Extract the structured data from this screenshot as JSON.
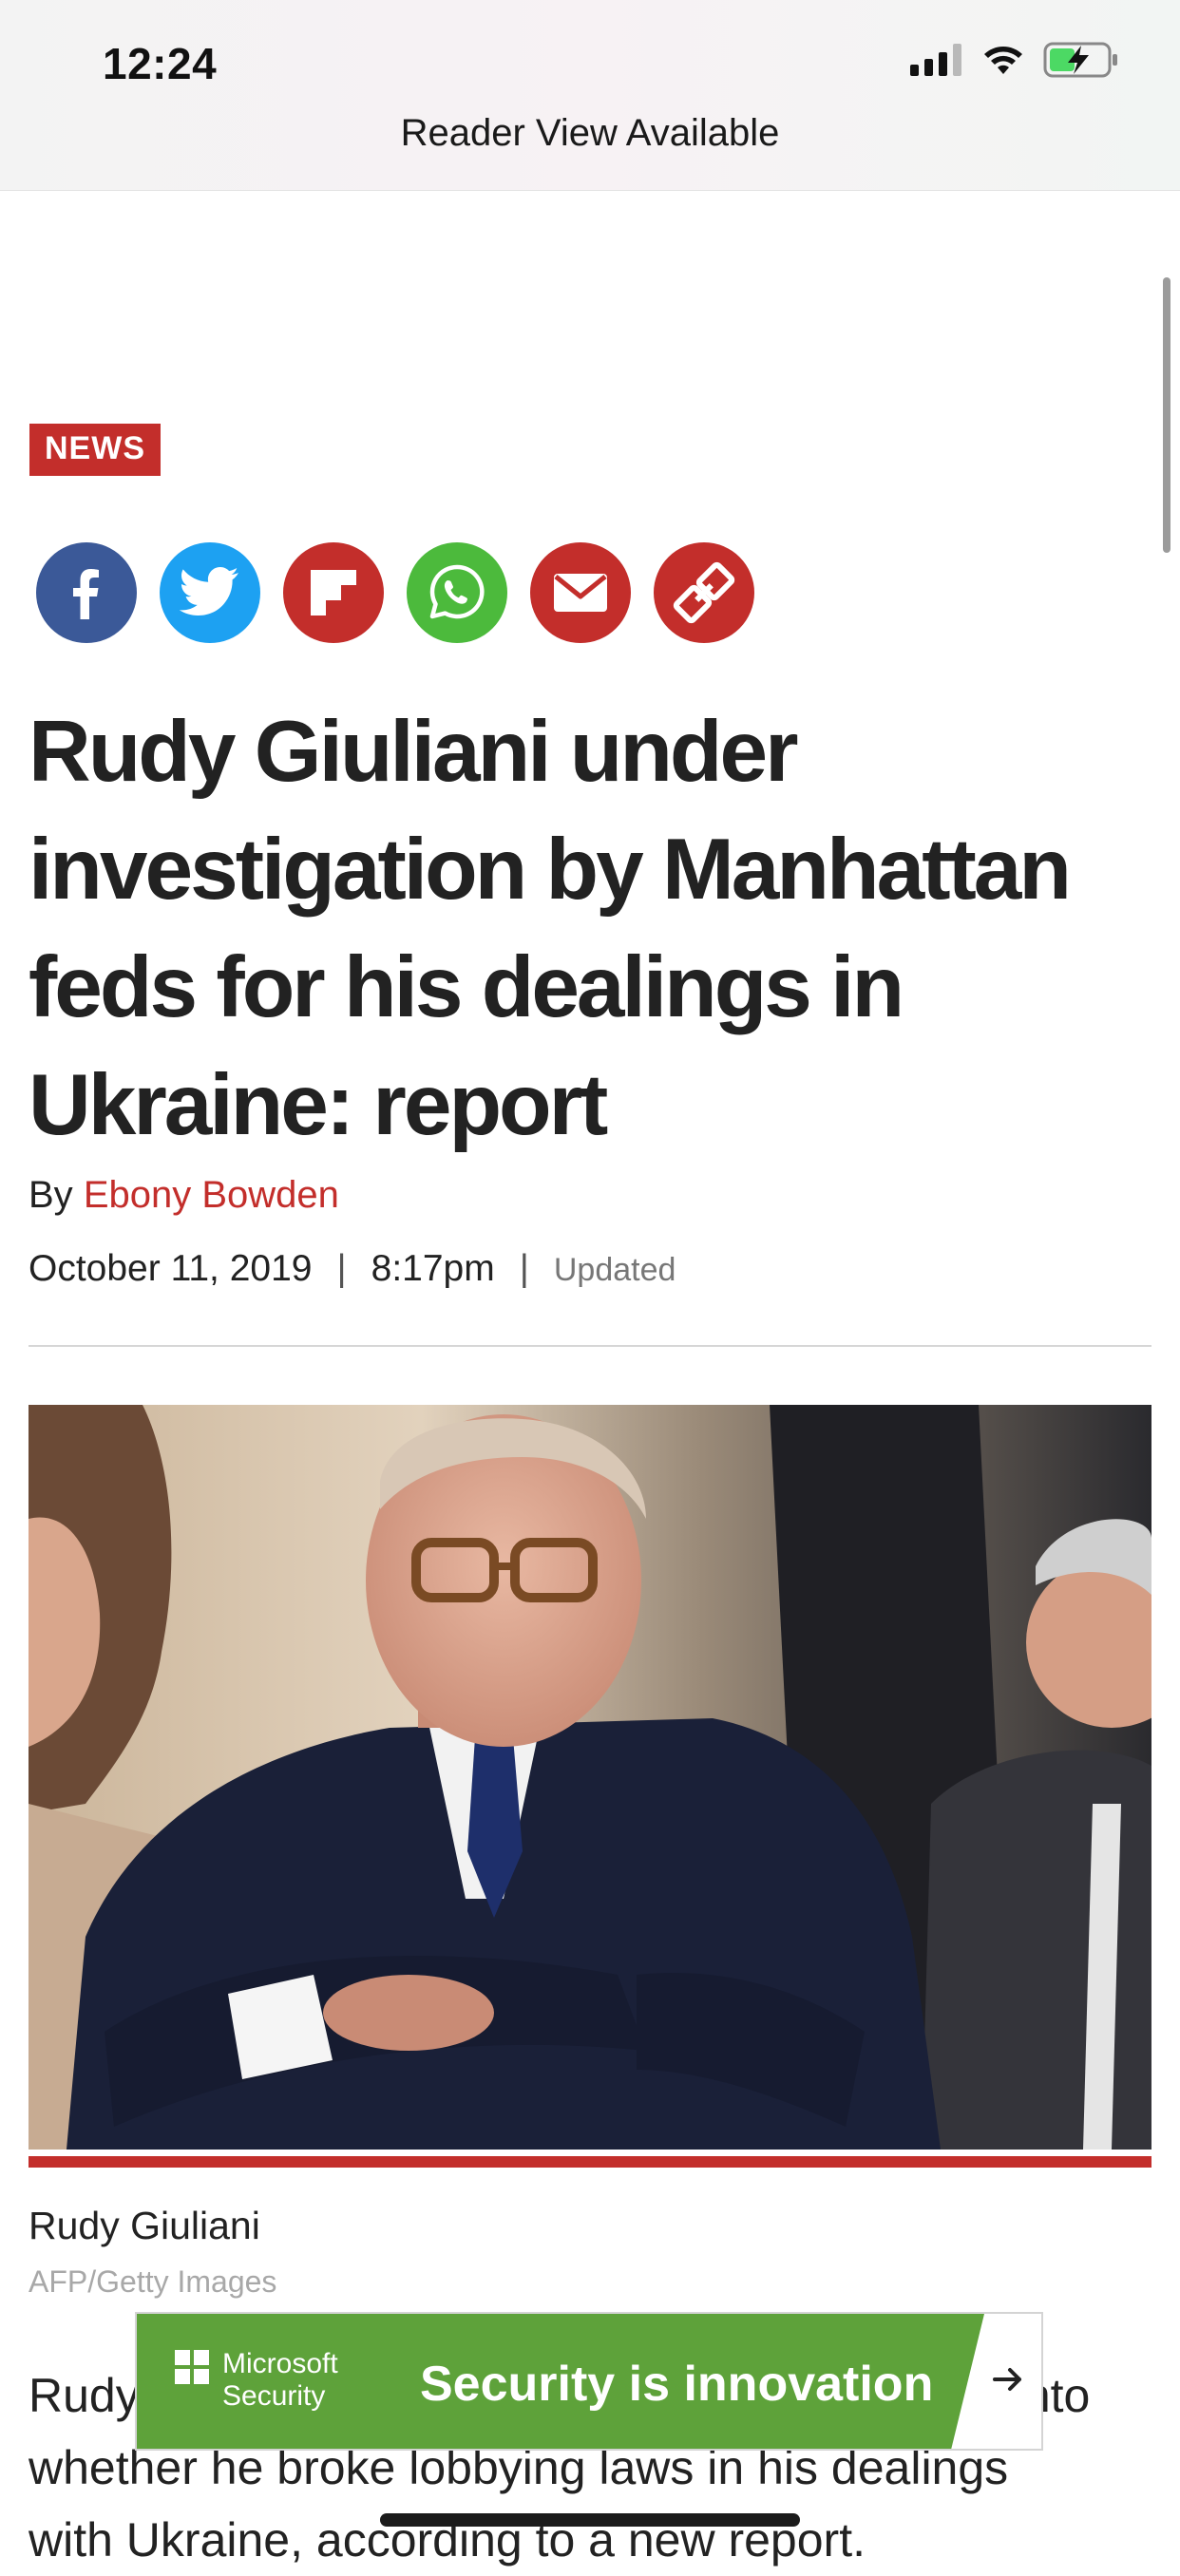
{
  "status_bar": {
    "time": "12:24"
  },
  "reader_view_label": "Reader View Available",
  "article": {
    "category_badge": "NEWS",
    "share_buttons": [
      {
        "icon": "facebook-icon",
        "color": "#3b5998"
      },
      {
        "icon": "twitter-icon",
        "color": "#1da1f2"
      },
      {
        "icon": "flipboard-icon",
        "color": "#c32e2b"
      },
      {
        "icon": "whatsapp-icon",
        "color": "#4cba3c"
      },
      {
        "icon": "email-icon",
        "color": "#c32e2b"
      },
      {
        "icon": "link-icon",
        "color": "#c32e2b"
      }
    ],
    "headline": "Rudy Giuliani under investigation by Manhattan feds for his dealings in Ukraine: report",
    "byline_prefix": "By",
    "author": "Ebony Bowden",
    "date": "October 11, 2019",
    "time": "8:17pm",
    "updated_label": "Updated",
    "separator": "|",
    "photo": {
      "caption": "Rudy Giuliani",
      "credit": "AFP/Getty Images"
    },
    "body": {
      "line1_start": "Rudy",
      "line1_end": "into",
      "line2": "whether he broke lobbying laws in his dealings",
      "line3": "with Ukraine, according to a new report."
    }
  },
  "ad": {
    "brand_line1": "Microsoft",
    "brand_line2": "Security",
    "headline": "Security is innovation",
    "arrow_icon": "arrow-right-icon",
    "color": "#5ea23a"
  },
  "colors": {
    "accent_red": "#c32e2b",
    "text": "#222222"
  }
}
